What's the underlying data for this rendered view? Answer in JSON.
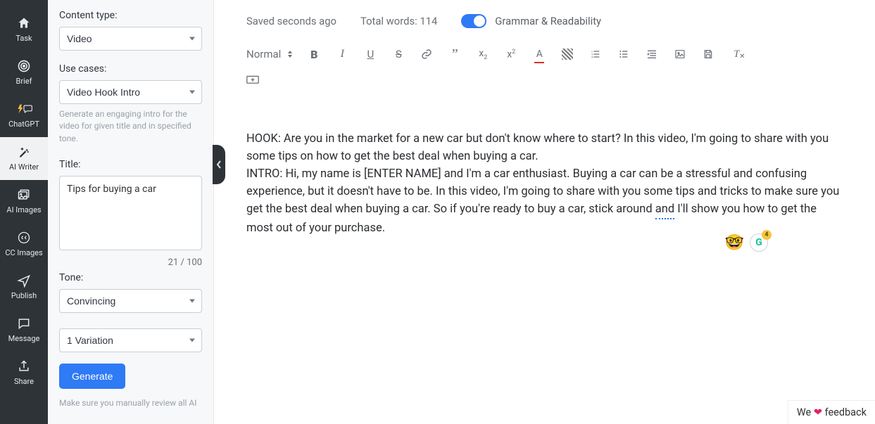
{
  "nav": {
    "items": [
      {
        "label": "Task",
        "icon": "home"
      },
      {
        "label": "Brief",
        "icon": "target"
      },
      {
        "label": "ChatGPT",
        "icon": "bolt-chat"
      },
      {
        "label": "AI Writer",
        "icon": "wand"
      },
      {
        "label": "AI Images",
        "icon": "images"
      },
      {
        "label": "CC Images",
        "icon": "cc"
      },
      {
        "label": "Publish",
        "icon": "send"
      },
      {
        "label": "Message",
        "icon": "message"
      },
      {
        "label": "Share",
        "icon": "share"
      }
    ],
    "active_index": 3
  },
  "panel": {
    "content_type_label": "Content type:",
    "content_type_value": "Video",
    "use_cases_label": "Use cases:",
    "use_case_value": "Video Hook Intro",
    "use_case_hint": "Generate an engaging intro for the video for given title and in specified tone.",
    "title_label": "Title:",
    "title_value": "Tips for buying a car",
    "title_counter": "21 / 100",
    "tone_label": "Tone:",
    "tone_value": "Convincing",
    "variation_value": "1 Variation",
    "generate_label": "Generate",
    "review_note": "Make sure you manually review all AI"
  },
  "topbar": {
    "saved": "Saved seconds ago",
    "wordcount": "Total words: 114",
    "toggle_label": "Grammar & Readability"
  },
  "toolbar": {
    "paragraph_label": "Normal"
  },
  "doc": {
    "hook_label": "HOOK: ",
    "hook_text": "Are you in the market for a new car but don't know where to start? In this video, I'm going to share with you some tips on how to get the best deal when buying a car.",
    "intro_label": "INTRO: ",
    "intro_text_a": "Hi, my name is [ENTER NAME] and I'm a car enthusiast. Buying a car can be a stressful and confusing experience, but it doesn't have to be. In this video, I'm going to share with you some tips and tricks to make sure you get the best deal when buying a car. So if you're ready to buy a car, stick around ",
    "intro_and": "and",
    "intro_text_b": " I'll show you how to get the most out of your purchase."
  },
  "badges": {
    "emoji": "🤓",
    "g": "G",
    "g_count": "4"
  },
  "feedback": {
    "pre": "We ",
    "heart": "❤",
    "post": " feedback"
  }
}
